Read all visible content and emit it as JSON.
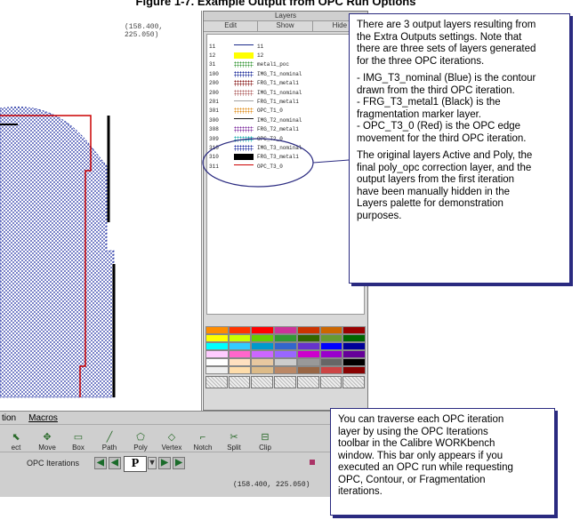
{
  "figure_title": "Figure 1-7. Example Output from OPC Run Options",
  "canvas": {
    "coords": "(158.400, 225.050)"
  },
  "layers_palette": {
    "title": "Layers",
    "columns": [
      "Edit",
      "Show",
      "Hide"
    ],
    "layers": [
      {
        "num": "11",
        "name": "11",
        "color": "#1a2a8a",
        "pattern": "line"
      },
      {
        "num": "12",
        "name": "12",
        "color": "#ffff00",
        "pattern": "solid"
      },
      {
        "num": "31",
        "name": "metal1_poc",
        "color": "#3a9a3a",
        "pattern": "dots"
      },
      {
        "num": "100",
        "name": "IMG_T1_nominal",
        "color": "#1a2a9a",
        "pattern": "dots"
      },
      {
        "num": "200",
        "name": "FRG_T1_metal1",
        "color": "#8a1a1a",
        "pattern": "dots"
      },
      {
        "num": "200",
        "name": "IMG_T1_nominal",
        "color": "#b06060",
        "pattern": "dots"
      },
      {
        "num": "201",
        "name": "FRG_T1_metal1",
        "color": "#a0a0a0",
        "pattern": "line"
      },
      {
        "num": "301",
        "name": "OPC_T1_0",
        "color": "#e09020",
        "pattern": "dots"
      },
      {
        "num": "300",
        "name": "IMG_T2_nominal",
        "color": "#1a1a1a",
        "pattern": "line"
      },
      {
        "num": "308",
        "name": "FRG_T2_metal1",
        "color": "#8030a0",
        "pattern": "dots"
      },
      {
        "num": "309",
        "name": "OPC_T2_0",
        "color": "#20b0b0",
        "pattern": "dots"
      },
      {
        "num": "310",
        "name": "IMG_T3_nominal",
        "color": "#1a2aa0",
        "pattern": "dots"
      },
      {
        "num": "310",
        "name": "FRG_T3_metal1",
        "color": "#000000",
        "pattern": "solid"
      },
      {
        "num": "311",
        "name": "OPC_T3_0",
        "color": "#cc0000",
        "pattern": "line"
      }
    ],
    "color_swatches": [
      [
        "#ff8c00",
        "#ff3300",
        "#ff0000",
        "#cc3399",
        "#cc3300",
        "#cc6600",
        "#990000"
      ],
      [
        "#ffff00",
        "#ccff00",
        "#66cc00",
        "#339933",
        "#336600",
        "#669933",
        "#006600"
      ],
      [
        "#00ffff",
        "#33ccff",
        "#0099cc",
        "#3366cc",
        "#6633cc",
        "#0000ff",
        "#000099"
      ],
      [
        "#ffccff",
        "#ff66cc",
        "#cc66ff",
        "#9966ff",
        "#cc00cc",
        "#9900cc",
        "#660099"
      ],
      [
        "#ffffff",
        "#ffe0c0",
        "#e8c8a0",
        "#cccccc",
        "#999999",
        "#666666",
        "#000000"
      ],
      [
        "#eeeeee",
        "#ffddaa",
        "#ddbb88",
        "#bb8866",
        "#996644",
        "#cc4444",
        "#880000"
      ]
    ]
  },
  "callout1": {
    "p1": [
      "There are 3 output layers resulting from",
      "the Extra Outputs settings. Note that",
      "there are three sets of layers generated",
      "for the three OPC iterations."
    ],
    "p2": [
      "- IMG_T3_nominal (Blue) is the contour",
      "drawn from the third OPC iteration.",
      "- FRG_T3_metal1 (Black) is the",
      "fragmentation marker layer.",
      "- OPC_T3_0 (Red) is the OPC edge",
      "movement for the third OPC iteration."
    ],
    "p3": [
      "The original layers Active and Poly, the",
      "final poly_opc correction layer, and the",
      "output layers from the first iteration",
      "have been manually hidden in the",
      "Layers palette for demonstration",
      "purposes."
    ]
  },
  "callout2": {
    "lines": [
      "You can traverse each OPC iteration",
      "layer by using the OPC Iterations",
      "toolbar in the Calibre WORKbench",
      "window. This bar only appears if you",
      "executed an OPC run while requesting",
      "OPC, Contour, or Fragmentation",
      "iterations."
    ]
  },
  "workbench": {
    "menu": [
      "tion",
      "Macros"
    ],
    "tools": [
      {
        "label": "ect",
        "icon": "select-icon"
      },
      {
        "label": "Move",
        "icon": "move-icon"
      },
      {
        "label": "Box",
        "icon": "box-icon"
      },
      {
        "label": "Path",
        "icon": "path-icon"
      },
      {
        "label": "Poly",
        "icon": "poly-icon"
      },
      {
        "label": "Vertex",
        "icon": "vertex-icon"
      },
      {
        "label": "Notch",
        "icon": "notch-icon"
      },
      {
        "label": "Split",
        "icon": "split-icon"
      },
      {
        "label": "Clip",
        "icon": "clip-icon"
      }
    ],
    "opc_toolbar": {
      "label": "OPC Iterations",
      "field_value": "P"
    },
    "status_coords": "(158.400, 225.050)"
  }
}
